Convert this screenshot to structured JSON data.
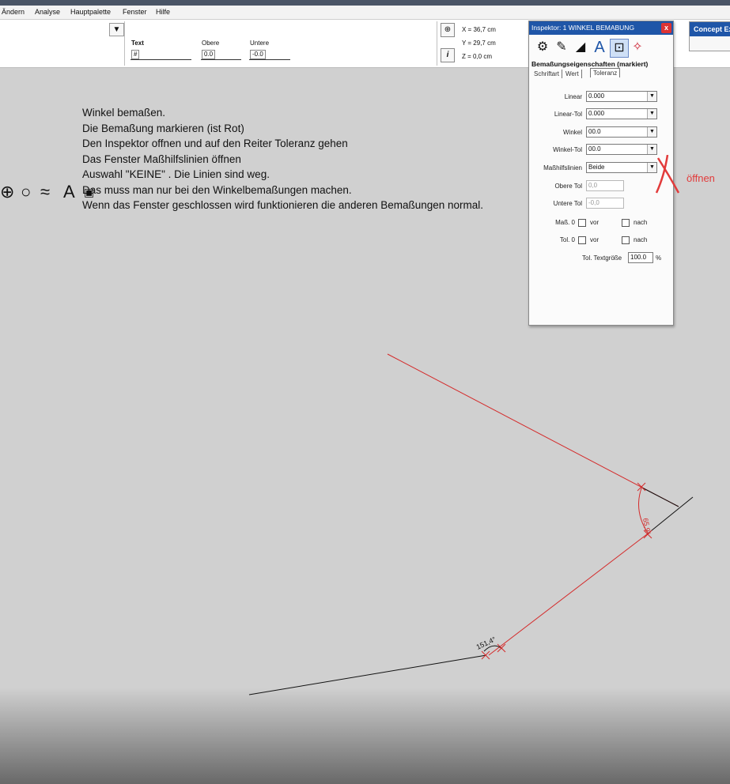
{
  "menu": [
    "Ändern",
    "Analyse",
    "Hauptpalette",
    "Fenster",
    "Hilfe"
  ],
  "toolbar": {
    "text_label": "Text",
    "text_value": "#",
    "obere_label": "Obere",
    "obere_value": "0.0",
    "untere_label": "Untere",
    "untere_value": "-0.0",
    "coord_x": "X = 36,7 cm",
    "coord_y": "Y = 29,7 cm",
    "coord_z": "Z = 0,0 cm",
    "info_icon": "i"
  },
  "concept": {
    "title": "Concept Ex"
  },
  "instructions": [
    "Winkel bemaßen.",
    "Die Bemaßung markieren (ist Rot)",
    "Den Inspektor offnen und auf den Reiter Toleranz gehen",
    "Das Fenster Maßhilfslinien öffnen",
    "Auswahl \"KEINE\" . Die Linien sind weg.",
    "Das muss man nur bei den Winkelbemaßungen machen.",
    "Wenn das Fenster geschlossen wird funktionieren die anderen Bemaßungen normal."
  ],
  "inspector": {
    "title": "Inspektor: 1 WINKEL BEMABUNG",
    "close": "x",
    "subtitle": "Bemaßungseigenschaften (markiert)",
    "tabs": [
      "Schriftart",
      "Wert",
      "Toleranz"
    ],
    "active_tab": "Toleranz",
    "fields": [
      {
        "label": "Linear",
        "value": "0.000",
        "dropdown": true
      },
      {
        "label": "Linear-Tol",
        "value": "0.000",
        "dropdown": true
      },
      {
        "label": "Winkel",
        "value": "00.0",
        "dropdown": true
      },
      {
        "label": "Winkel-Tol",
        "value": "00.0",
        "dropdown": true
      },
      {
        "label": "Maßhilfslinien",
        "value": "Beide",
        "dropdown": true
      },
      {
        "label": "Obere Tol",
        "value": "0,0",
        "dropdown": false
      },
      {
        "label": "Untere Tol",
        "value": "-0,0",
        "dropdown": false
      }
    ],
    "mass_label": "Maß. 0",
    "tol_label": "Tol. 0",
    "vor_label": "vor",
    "nach_label": "nach",
    "textsize_label": "Tol. Textgröße",
    "textsize_value": "100.0",
    "percent": "%"
  },
  "annotation": {
    "text": "öffnen",
    "color": "#e23b3b"
  },
  "drawing": {
    "angle1": "65,9°",
    "angle2": "151,4°",
    "dim_color": "#d42a2a",
    "line_color": "#111111"
  },
  "colors": {
    "inspector_title": "#1f56a8",
    "canvas": "#d0d0d0"
  }
}
